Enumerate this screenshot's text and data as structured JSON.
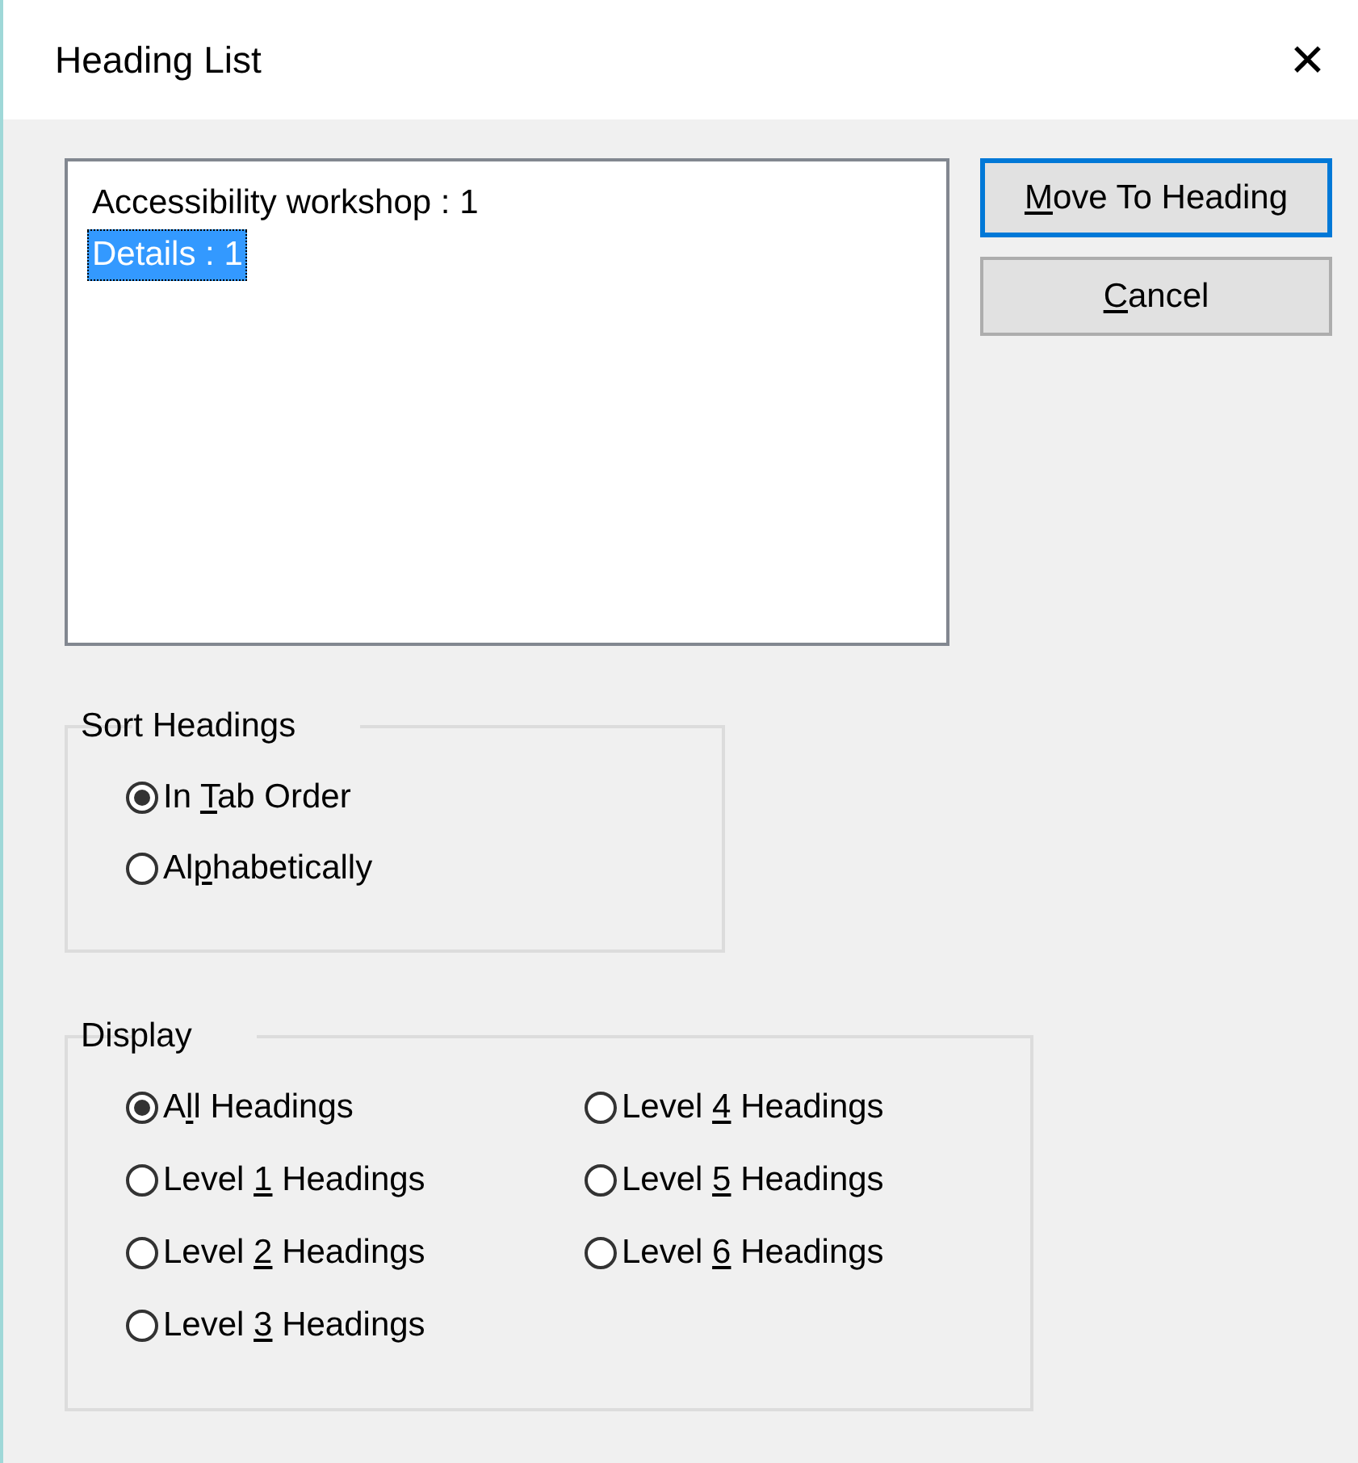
{
  "window": {
    "title": "Heading List",
    "close": "✕"
  },
  "headings_list": {
    "items": [
      {
        "label": "Accessibility workshop : 1",
        "selected": false
      },
      {
        "label": "Details : 1",
        "selected": true
      }
    ]
  },
  "buttons": [
    {
      "access_key": "M",
      "text_after": "ove To Heading",
      "default": true
    },
    {
      "access_key": "C",
      "text_after": "ancel",
      "default": false
    }
  ],
  "sort_headings": {
    "title": "Sort Headings",
    "options": [
      {
        "text_before": "In ",
        "access_key": "T",
        "text_after": "ab Order",
        "selected": true
      },
      {
        "text_before": "Al",
        "access_key": "p",
        "text_after": "habetically",
        "selected": false
      }
    ]
  },
  "display": {
    "title": "Display",
    "options": [
      {
        "text_before": "A",
        "access_key": "l",
        "text_after": "l Headings",
        "selected": true
      },
      {
        "text_before": "Level ",
        "access_key": "1",
        "text_after": " Headings",
        "selected": false
      },
      {
        "text_before": "Level ",
        "access_key": "2",
        "text_after": " Headings",
        "selected": false
      },
      {
        "text_before": "Level ",
        "access_key": "3",
        "text_after": " Headings",
        "selected": false
      },
      {
        "text_before": "Level ",
        "access_key": "4",
        "text_after": " Headings",
        "selected": false
      },
      {
        "text_before": "Level ",
        "access_key": "5",
        "text_after": " Headings",
        "selected": false
      },
      {
        "text_before": "Level ",
        "access_key": "6",
        "text_after": " Headings",
        "selected": false
      }
    ]
  }
}
